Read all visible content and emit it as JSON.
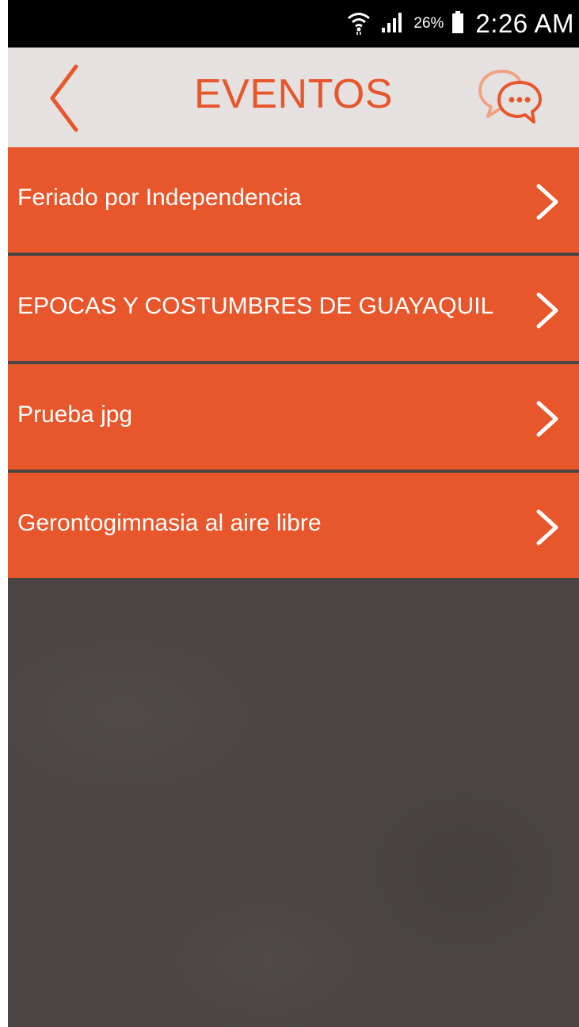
{
  "status_bar": {
    "battery_percent": "26%",
    "time": "2:26 AM",
    "icons": [
      "wifi-icon",
      "signal-icon",
      "battery-icon"
    ]
  },
  "header": {
    "title": "EVENTOS",
    "back_icon": "back-chevron-icon",
    "chat_icon": "chat-bubbles-icon"
  },
  "events": [
    {
      "label": "Feriado por Independencia"
    },
    {
      "label": "EPOCAS Y COSTUMBRES DE GUAYAQUIL"
    },
    {
      "label": "Prueba jpg"
    },
    {
      "label": "Gerontogimnasia al aire libre"
    }
  ],
  "colors": {
    "accent": "#e8562b",
    "header_bg": "#e6e1e1",
    "background": "#4a4544",
    "status_bar": "#000000"
  }
}
